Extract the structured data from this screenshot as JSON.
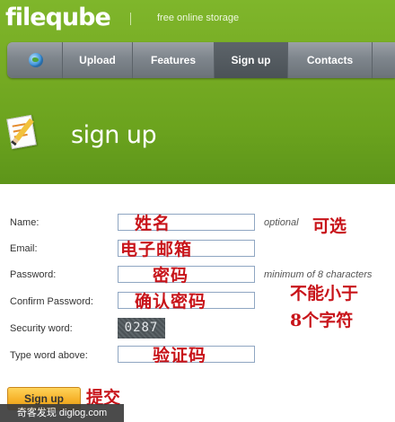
{
  "header": {
    "logo": "fileqube",
    "tagline": "free online storage"
  },
  "nav": {
    "items": [
      "Upload",
      "Features",
      "Sign up",
      "Contacts"
    ],
    "active": "Sign up"
  },
  "page": {
    "title": "sign up"
  },
  "form": {
    "name_label": "Name:",
    "name_hint": "optional",
    "name_note": "姓名",
    "email_label": "Email:",
    "email_note": "电子邮箱",
    "password_label": "Password:",
    "password_hint": "minimum of 8 characters",
    "password_note": "密码",
    "confirm_label": "Confirm Password:",
    "confirm_note": "确认密码",
    "security_label": "Security word:",
    "captcha_text": "0287",
    "type_label": "Type word above:",
    "type_note": "验证码",
    "submit_label": "Sign up"
  },
  "annotations": {
    "optional": "可选",
    "min_chars_line1": "不能小于",
    "min_chars_line2": "8个字符",
    "submit": "提交"
  },
  "watermark": "奇客发现 diglog.com",
  "colors": {
    "brand_green": "#77ac24",
    "nav_gray": "#7e858c",
    "annotation_red": "#c8141a",
    "button_orange": "#f6b22a"
  }
}
